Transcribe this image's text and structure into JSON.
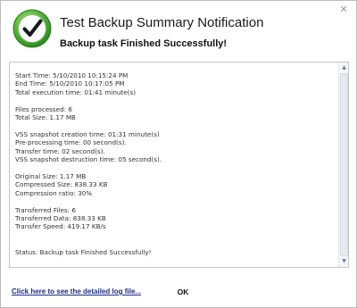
{
  "window": {
    "title": "Test Backup Summary Notification",
    "subtitle": "Backup task Finished Successfully!",
    "close_icon": "close-icon"
  },
  "colors": {
    "badge_green_dark": "#2d8a23",
    "badge_green_light": "#8cd36a",
    "link": "#1e2a8c"
  },
  "log": {
    "lines": [
      "Start Time: 5/10/2010 10:15:24 PM",
      "End Time: 5/10/2010 10:17:05 PM",
      "Total execution time: 01:41 minute(s)",
      "",
      "Files processed: 6",
      "Total Size: 1.17 MB",
      "",
      "VSS snapshot creation time: 01:31 minute(s)",
      "Pre-processing time: 00 second(s).",
      "Transfer time: 02 second(s).",
      "VSS snapshot destruction time: 05 second(s).",
      "",
      "Original Size: 1.17 MB",
      "Compressed Size: 838.33 KB",
      "Compression ratio: 30%",
      "",
      "Transferred Files: 6",
      "Transferred Data: 838.33 KB",
      "Transfer Speed: 419.17 KB/s",
      "",
      "",
      "Status: Backup task Finished Successfully!"
    ]
  },
  "footer": {
    "log_link": "Click here to see the detailed log file...",
    "ok_label": "OK"
  }
}
